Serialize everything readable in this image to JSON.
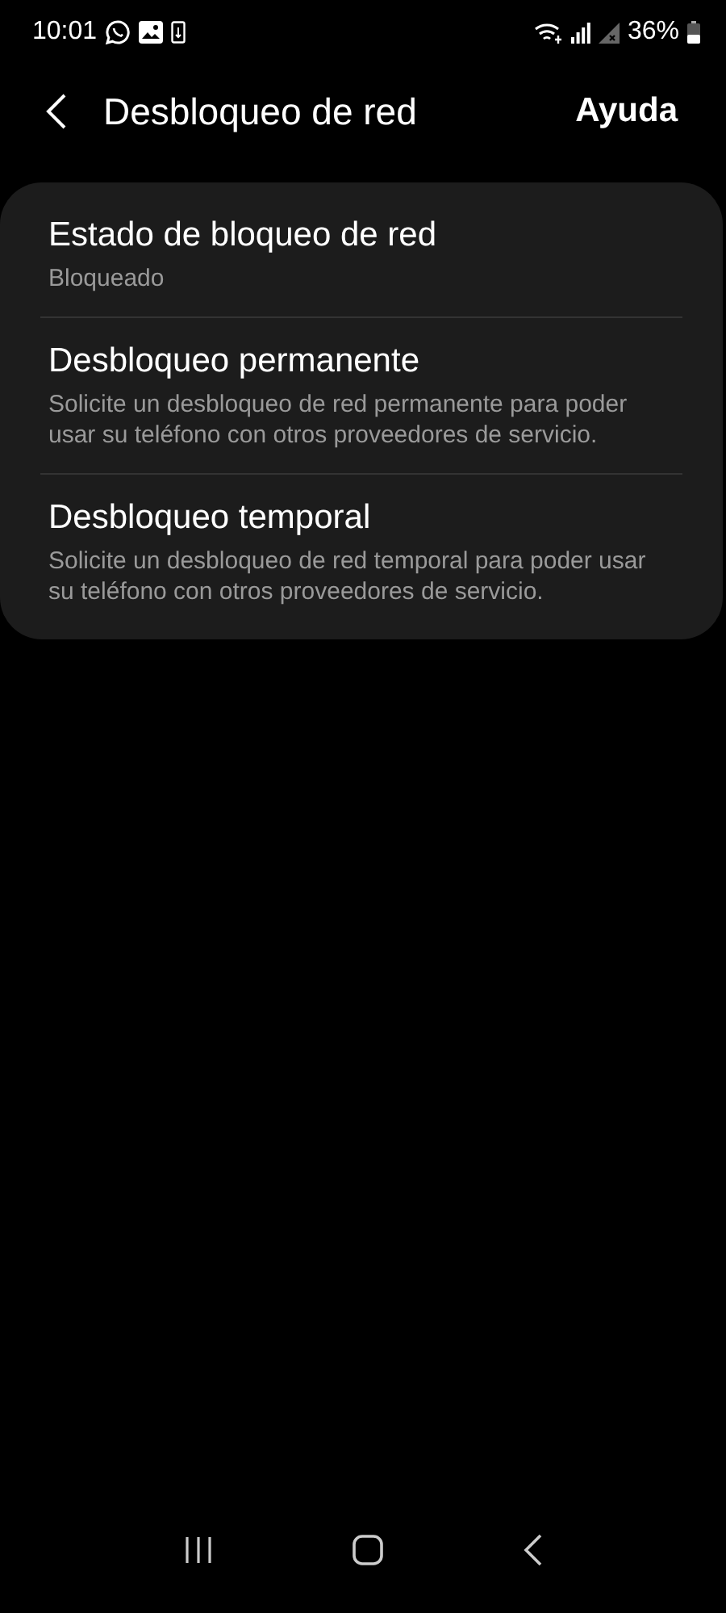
{
  "status_bar": {
    "time": "10:01",
    "battery": "36%"
  },
  "header": {
    "title": "Desbloqueo de red",
    "action": "Ayuda"
  },
  "items": [
    {
      "title": "Estado de bloqueo de red",
      "subtitle": "Bloqueado"
    },
    {
      "title": "Desbloqueo permanente",
      "subtitle": "Solicite un desbloqueo de red permanente para poder usar su teléfono con otros proveedores de servicio."
    },
    {
      "title": "Desbloqueo temporal",
      "subtitle": "Solicite un desbloqueo de red temporal para poder usar su teléfono con otros proveedores de servicio."
    }
  ]
}
